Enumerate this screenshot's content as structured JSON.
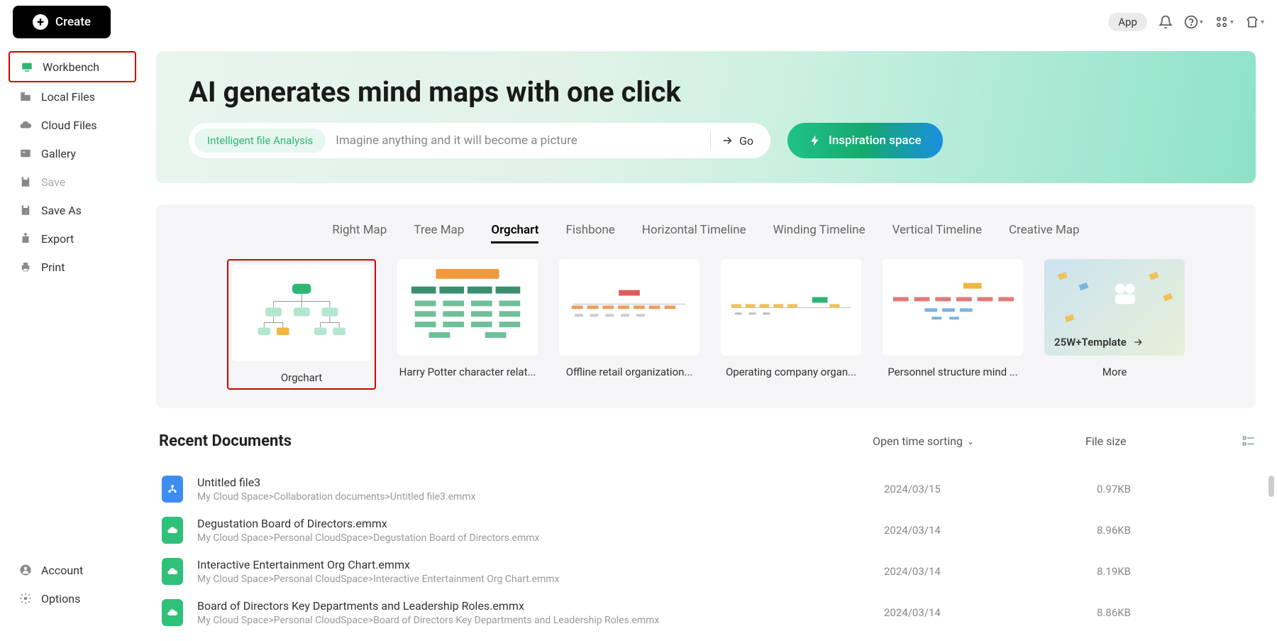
{
  "topbar": {
    "create_label": "Create",
    "app_label": "App"
  },
  "sidebar": {
    "items": [
      {
        "label": "Workbench"
      },
      {
        "label": "Local Files"
      },
      {
        "label": "Cloud Files"
      },
      {
        "label": "Gallery"
      },
      {
        "label": "Save"
      },
      {
        "label": "Save As"
      },
      {
        "label": "Export"
      },
      {
        "label": "Print"
      }
    ],
    "bottom": [
      {
        "label": "Account"
      },
      {
        "label": "Options"
      }
    ]
  },
  "hero": {
    "title": "AI generates mind maps with one click",
    "analysis_pill": "Intelligent file Analysis",
    "placeholder": "Imagine anything and it will become a picture",
    "go_label": "Go",
    "inspiration_label": "Inspiration space"
  },
  "templates": {
    "tabs": [
      {
        "label": "Right Map"
      },
      {
        "label": "Tree Map"
      },
      {
        "label": "Orgchart"
      },
      {
        "label": "Fishbone"
      },
      {
        "label": "Horizontal Timeline"
      },
      {
        "label": "Winding Timeline"
      },
      {
        "label": "Vertical Timeline"
      },
      {
        "label": "Creative Map"
      }
    ],
    "active_index": 2,
    "cards": [
      {
        "label": "Orgchart"
      },
      {
        "label": "Harry Potter character relat..."
      },
      {
        "label": "Offline retail organization..."
      },
      {
        "label": "Operating company organ..."
      },
      {
        "label": "Personnel structure mind ..."
      },
      {
        "label": "More"
      }
    ],
    "more_text": "25W+Template"
  },
  "recent": {
    "title": "Recent Documents",
    "sort_label": "Open time sorting",
    "size_label": "File size",
    "docs": [
      {
        "name": "Untitled file3",
        "path": "My Cloud Space>Collaboration documents>Untitled file3.emmx",
        "date": "2024/03/15",
        "size": "0.97KB",
        "color": "blue"
      },
      {
        "name": "Degustation Board of Directors.emmx",
        "path": "My Cloud Space>Personal CloudSpace>Degustation Board of Directors.emmx",
        "date": "2024/03/14",
        "size": "8.96KB",
        "color": "green"
      },
      {
        "name": "Interactive Entertainment Org Chart.emmx",
        "path": "My Cloud Space>Personal CloudSpace>Interactive Entertainment Org Chart.emmx",
        "date": "2024/03/14",
        "size": "8.19KB",
        "color": "green"
      },
      {
        "name": "Board of Directors Key Departments and Leadership Roles.emmx",
        "path": "My Cloud Space>Personal CloudSpace>Board of Directors Key Departments and Leadership Roles.emmx",
        "date": "2024/03/14",
        "size": "8.86KB",
        "color": "green"
      }
    ]
  }
}
